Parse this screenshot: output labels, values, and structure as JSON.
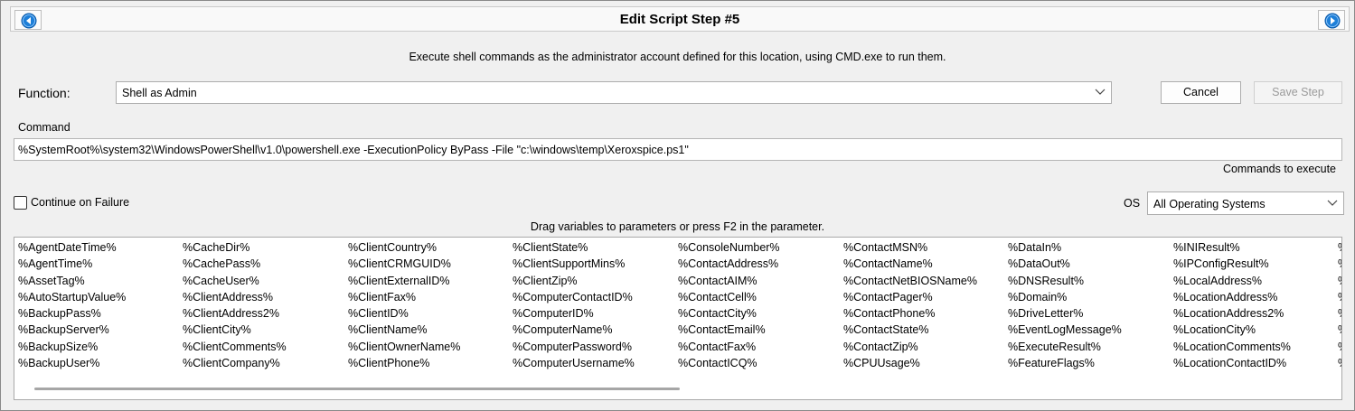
{
  "window": {
    "title": "Edit Script Step #5",
    "prev_icon": "circle-left-arrow-icon",
    "next_icon": "circle-right-arrow-icon",
    "accent_color": "#1e7fd8"
  },
  "description": "Execute shell commands as the administrator account defined for this location, using CMD.exe to run them.",
  "function": {
    "label": "Function:",
    "value": "Shell as Admin"
  },
  "buttons": {
    "cancel": "Cancel",
    "save": "Save Step"
  },
  "command": {
    "label": "Command",
    "value": "%SystemRoot%\\system32\\WindowsPowerShell\\v1.0\\powershell.exe -ExecutionPolicy ByPass -File \"c:\\windows\\temp\\Xeroxspice.ps1\"",
    "hint": "Commands to execute"
  },
  "continue_on_failure": {
    "label": "Continue on Failure",
    "checked": false
  },
  "os": {
    "label": "OS",
    "value": "All Operating Systems"
  },
  "drag_hint": "Drag variables to parameters or press F2 in the parameter.",
  "variables": [
    [
      "%AgentDateTime%",
      "%AgentTime%",
      "%AssetTag%",
      "%AutoStartupValue%",
      "%BackupPass%",
      "%BackupServer%",
      "%BackupSize%",
      "%BackupUser%"
    ],
    [
      "%CacheDir%",
      "%CachePass%",
      "%CacheUser%",
      "%ClientAddress%",
      "%ClientAddress2%",
      "%ClientCity%",
      "%ClientComments%",
      "%ClientCompany%"
    ],
    [
      "%ClientCountry%",
      "%ClientCRMGUID%",
      "%ClientExternalID%",
      "%ClientFax%",
      "%ClientID%",
      "%ClientName%",
      "%ClientOwnerName%",
      "%ClientPhone%"
    ],
    [
      "%ClientState%",
      "%ClientSupportMins%",
      "%ClientZip%",
      "%ComputerContactID%",
      "%ComputerID%",
      "%ComputerName%",
      "%ComputerPassword%",
      "%ComputerUsername%"
    ],
    [
      "%ConsoleNumber%",
      "%ContactAddress%",
      "%ContactAIM%",
      "%ContactCell%",
      "%ContactCity%",
      "%ContactEmail%",
      "%ContactFax%",
      "%ContactICQ%"
    ],
    [
      "%ContactMSN%",
      "%ContactName%",
      "%ContactNetBIOSName%",
      "%ContactPager%",
      "%ContactPhone%",
      "%ContactState%",
      "%ContactZip%",
      "%CPUUsage%"
    ],
    [
      "%DataIn%",
      "%DataOut%",
      "%DNSResult%",
      "%Domain%",
      "%DriveLetter%",
      "%EventLogMessage%",
      "%ExecuteResult%",
      "%FeatureFlags%"
    ],
    [
      "%INIResult%",
      "%IPConfigResult%",
      "%LocalAddress%",
      "%LocationAddress%",
      "%LocationAddress2%",
      "%LocationCity%",
      "%LocationComments%",
      "%LocationContactID%"
    ],
    [
      "%",
      "%",
      "%",
      "%",
      "%",
      "%",
      "%",
      "%"
    ]
  ]
}
